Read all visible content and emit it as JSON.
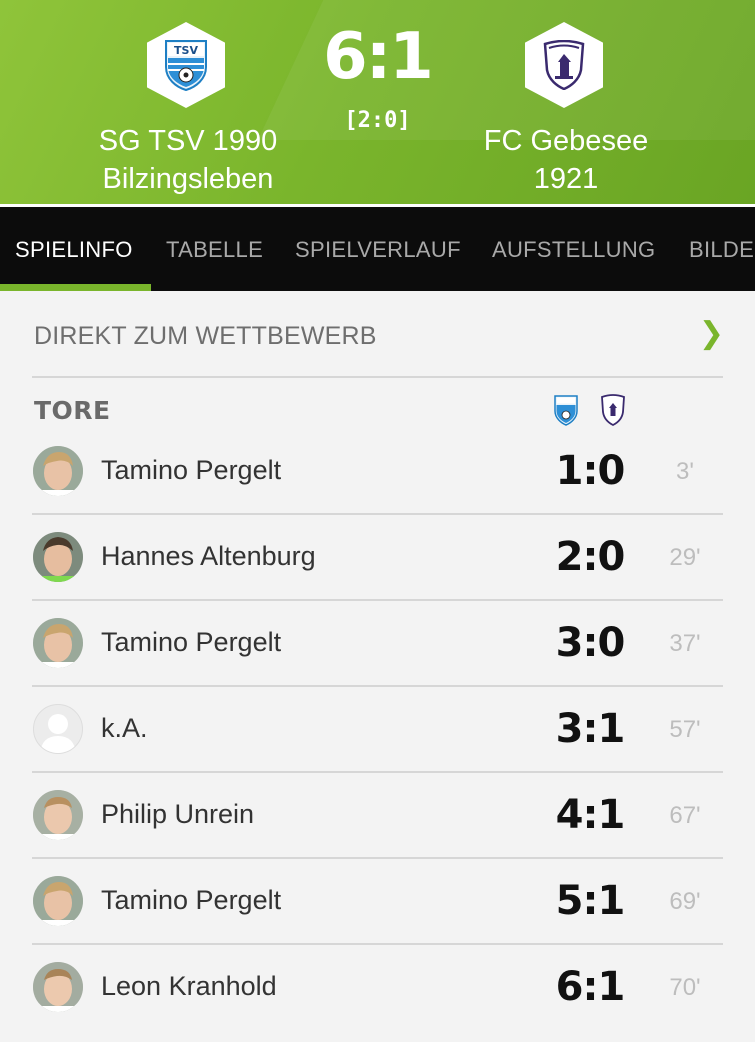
{
  "match": {
    "home_team": {
      "name_line1": "SG TSV 1990",
      "name_line2": "Bilzingsleben",
      "badge_text": "TSV"
    },
    "away_team": {
      "name_line1": "FC Gebesee",
      "name_line2": "1921"
    },
    "score": "6:1",
    "halftime": "[2:0]"
  },
  "tabs": [
    {
      "label": "SPIELINFO",
      "active": true
    },
    {
      "label": "TABELLE",
      "active": false
    },
    {
      "label": "SPIELVERLAUF",
      "active": false
    },
    {
      "label": "AUFSTELLUNG",
      "active": false
    },
    {
      "label": "BILDE",
      "active": false
    }
  ],
  "competition_link": {
    "label": "DIREKT ZUM WETTBEWERB",
    "icon": "chevron-right-icon"
  },
  "goals_section": {
    "title": "TORE",
    "goals": [
      {
        "player": "Tamino Pergelt",
        "score": "1:0",
        "minute": "3'",
        "avatar": "photo"
      },
      {
        "player": "Hannes Altenburg",
        "score": "2:0",
        "minute": "29'",
        "avatar": "photo"
      },
      {
        "player": "Tamino Pergelt",
        "score": "3:0",
        "minute": "37'",
        "avatar": "photo"
      },
      {
        "player": "k.A.",
        "score": "3:1",
        "minute": "57'",
        "avatar": "placeholder"
      },
      {
        "player": "Philip Unrein",
        "score": "4:1",
        "minute": "67'",
        "avatar": "photo"
      },
      {
        "player": "Tamino Pergelt",
        "score": "5:1",
        "minute": "69'",
        "avatar": "photo"
      },
      {
        "player": "Leon Kranhold",
        "score": "6:1",
        "minute": "70'",
        "avatar": "photo"
      }
    ]
  },
  "colors": {
    "accent": "#7ab52c",
    "tab_bar": "#0c0c0c",
    "background": "#f3f3f3"
  }
}
